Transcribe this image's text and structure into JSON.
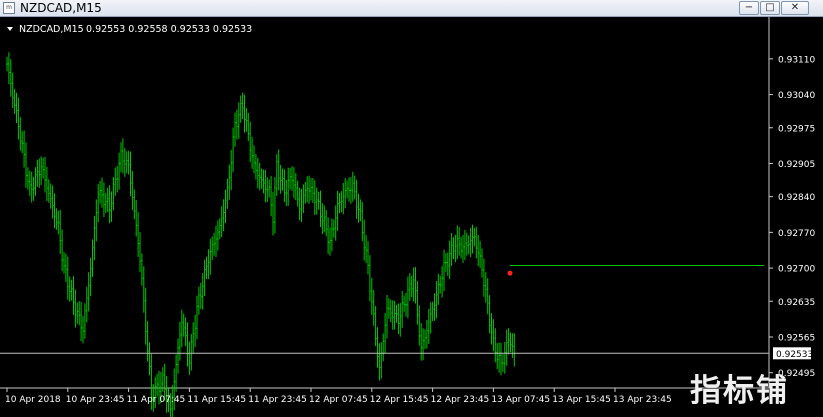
{
  "window": {
    "title": "NZDCAD,M15",
    "min_glyph": "−",
    "max_glyph": "□",
    "close_glyph": "✕"
  },
  "header": {
    "symbol": "NZDCAD,M15",
    "quote": "0.92553 0.92558 0.92533 0.92533"
  },
  "watermark": {
    "text": "指标铺"
  },
  "colors": {
    "background": "#000000",
    "bars": "#00c800",
    "axis": "#c8c8c8",
    "text": "#ffffff",
    "marker": "#ff2020",
    "line": "#00c800"
  },
  "chart_data": {
    "type": "ohlc",
    "ylim": [
      0.92465,
      0.93145
    ],
    "yticks": [
      0.9311,
      0.9304,
      0.92975,
      0.92905,
      0.9284,
      0.9277,
      0.927,
      0.92635,
      0.92565,
      0.92495
    ],
    "ytick_labels": [
      "0.93110",
      "0.93040",
      "0.92975",
      "0.92905",
      "0.92840",
      "0.92770",
      "0.92700",
      "0.92635",
      "0.92565",
      "0.92495"
    ],
    "x_labels": [
      "10 Apr 2018",
      "10 Apr 23:45",
      "11 Apr 07:45",
      "11 Apr 15:45",
      "11 Apr 23:45",
      "12 Apr 07:45",
      "12 Apr 15:45",
      "12 Apr 23:45",
      "13 Apr 07:45",
      "13 Apr 15:45",
      "13 Apr 23:45"
    ],
    "bars_per_label": 32,
    "last_price": 0.92533,
    "last_price_label": "0.92533",
    "horizontal_level": 0.92705,
    "marker_value": 0.9269,
    "anchors": [
      [
        0,
        0.931
      ],
      [
        6,
        0.9298
      ],
      [
        12,
        0.9285
      ],
      [
        18,
        0.929
      ],
      [
        24,
        0.9282
      ],
      [
        27,
        0.9278
      ],
      [
        30,
        0.927
      ],
      [
        36,
        0.9262
      ],
      [
        40,
        0.9258
      ],
      [
        44,
        0.927
      ],
      [
        48,
        0.9285
      ],
      [
        54,
        0.9282
      ],
      [
        60,
        0.9292
      ],
      [
        64,
        0.929
      ],
      [
        70,
        0.9272
      ],
      [
        76,
        0.9245
      ],
      [
        82,
        0.9248
      ],
      [
        86,
        0.9242
      ],
      [
        92,
        0.926
      ],
      [
        96,
        0.9252
      ],
      [
        100,
        0.9262
      ],
      [
        106,
        0.9272
      ],
      [
        112,
        0.9278
      ],
      [
        116,
        0.9285
      ],
      [
        120,
        0.9298
      ],
      [
        124,
        0.9302
      ],
      [
        126,
        0.9298
      ],
      [
        130,
        0.929
      ],
      [
        134,
        0.9287
      ],
      [
        138,
        0.9285
      ],
      [
        140,
        0.928
      ],
      [
        142,
        0.929
      ],
      [
        146,
        0.9285
      ],
      [
        150,
        0.9288
      ],
      [
        154,
        0.9282
      ],
      [
        158,
        0.9286
      ],
      [
        162,
        0.9284
      ],
      [
        166,
        0.928
      ],
      [
        170,
        0.9275
      ],
      [
        174,
        0.9282
      ],
      [
        178,
        0.9285
      ],
      [
        182,
        0.9286
      ],
      [
        186,
        0.928
      ],
      [
        190,
        0.927
      ],
      [
        196,
        0.925
      ],
      [
        200,
        0.9262
      ],
      [
        206,
        0.926
      ],
      [
        210,
        0.9264
      ],
      [
        214,
        0.9268
      ],
      [
        218,
        0.9254
      ],
      [
        224,
        0.9262
      ],
      [
        230,
        0.927
      ],
      [
        236,
        0.9275
      ],
      [
        240,
        0.9274
      ],
      [
        246,
        0.9276
      ],
      [
        250,
        0.927
      ],
      [
        256,
        0.9255
      ],
      [
        260,
        0.9251
      ],
      [
        264,
        0.9256
      ],
      [
        267,
        0.9254
      ]
    ]
  }
}
